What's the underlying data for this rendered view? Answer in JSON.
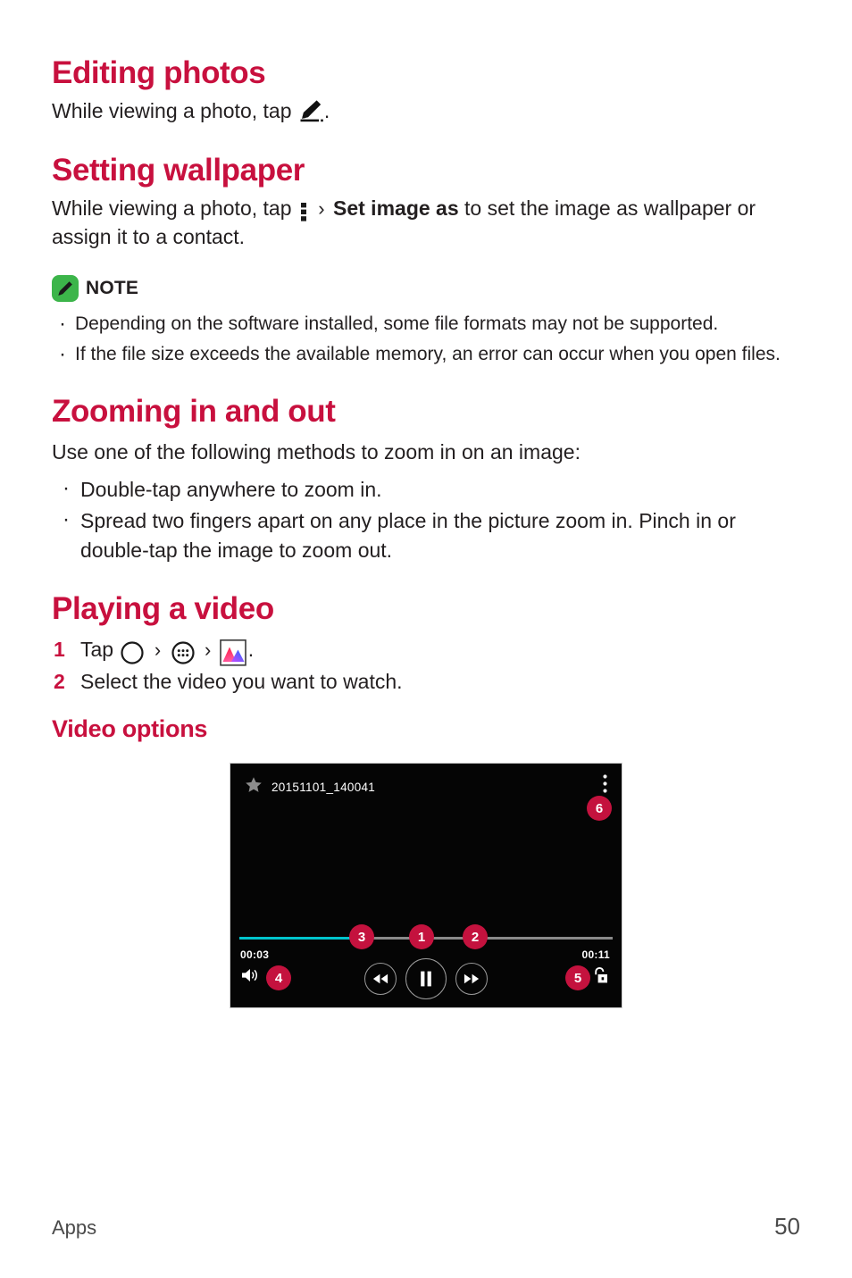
{
  "sections": {
    "editing_photos": {
      "title": "Editing photos",
      "body_before": "While viewing a photo, tap",
      "body_after": "."
    },
    "setting_wallpaper": {
      "title": "Setting wallpaper",
      "body_1": "While viewing a photo, tap",
      "chevron": "›",
      "bold_term": "Set image as",
      "body_2": "to set the image as wallpaper or assign it to a contact."
    },
    "note": {
      "label": "NOTE",
      "items": [
        "Depending on the software installed, some file formats may not be supported.",
        "If the file size exceeds the available memory, an error can occur when you open files."
      ]
    },
    "zooming": {
      "title": "Zooming in and out",
      "intro": "Use one of the following methods to zoom in on an image:",
      "items": [
        "Double-tap anywhere to zoom in.",
        "Spread two fingers apart on any place in the picture zoom in. Pinch in or double-tap the image to zoom out."
      ]
    },
    "playing_video": {
      "title": "Playing a video",
      "steps": [
        {
          "num": "1",
          "text_before": "Tap",
          "chevron": "›",
          "text_after": "."
        },
        {
          "num": "2",
          "text": "Select the video you want to watch."
        }
      ],
      "subheading": "Video options"
    }
  },
  "player": {
    "filename": "20151101_140041",
    "time_current": "00:03",
    "time_total": "00:11",
    "progress_percent": 33,
    "callouts": [
      "1",
      "2",
      "3",
      "4",
      "5",
      "6"
    ]
  },
  "footer": {
    "label": "Apps",
    "page": "50"
  },
  "colors": {
    "heading": "#c8103e",
    "callout": "#c4123e",
    "note_badge": "#3cb54a",
    "seek_fill": "#00c4cc",
    "seek_track": "#8a8a8a",
    "player_bg": "#050505"
  }
}
